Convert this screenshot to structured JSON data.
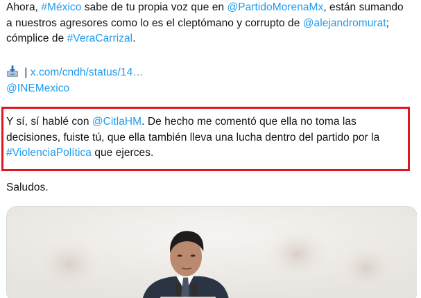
{
  "tweet": {
    "p1": {
      "t1": "Ahora, ",
      "h1": "#México",
      "t2": " sabe de tu propia voz que en ",
      "m1": "@PartidoMorenaMx",
      "t3": ", están sumando a nuestros agresores como lo es el cleptómano y corrupto de ",
      "m2": "@alejandromurat",
      "t4": "; cómplice de ",
      "h2": "#VeraCarrizal",
      "t5": "."
    },
    "p2": {
      "icon": "inbox-tray-icon",
      "sep": " | ",
      "url": "x.com/cndh/status/14…",
      "mention": "@INEMexico"
    },
    "p3": {
      "t1": "Y sí, sí hablé con ",
      "m1": "@CitlaHM",
      "t2": ". De hecho me comentó que ella no toma las decisiones, fuiste tú, que ella también lleva una lucha dentro del partido por la ",
      "h1": "#ViolenciaPolítica",
      "t3": " que ejerces."
    },
    "p4": "Saludos."
  },
  "highlight": {
    "color": "#e0161e"
  },
  "colors": {
    "link": "#1d9bf0",
    "text": "#0f1419",
    "card_border": "#cfd9de"
  },
  "media": {
    "kind": "video-thumbnail"
  }
}
